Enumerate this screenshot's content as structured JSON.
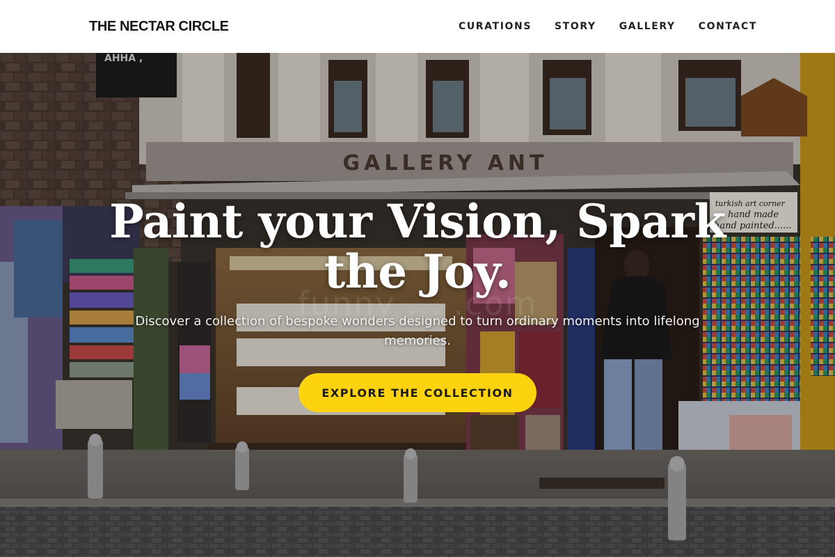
{
  "nav": {
    "brand": "THE NECTAR CIRCLE",
    "links": [
      "CURATIONS",
      "STORY",
      "GALLERY",
      "CONTACT"
    ]
  },
  "hero": {
    "headline": "Paint your Vision, Spark the Joy.",
    "subheadline": "Discover a collection of bespoke wonders designed to turn ordinary moments into lifelong memories.",
    "cta_label": "EXPLORE THE COLLECTION",
    "watermark": "funny ... .com",
    "photo_signs": {
      "shop_sign": "GALLERY ANT",
      "board_line1": "turkish art corner",
      "board_line2": "hand made",
      "board_line3": "hand painted......",
      "top_sign": "AHHA ,"
    }
  },
  "colors": {
    "cta_background": "#fdd20f",
    "nav_background": "#ffffff",
    "headline": "#ffffff"
  }
}
